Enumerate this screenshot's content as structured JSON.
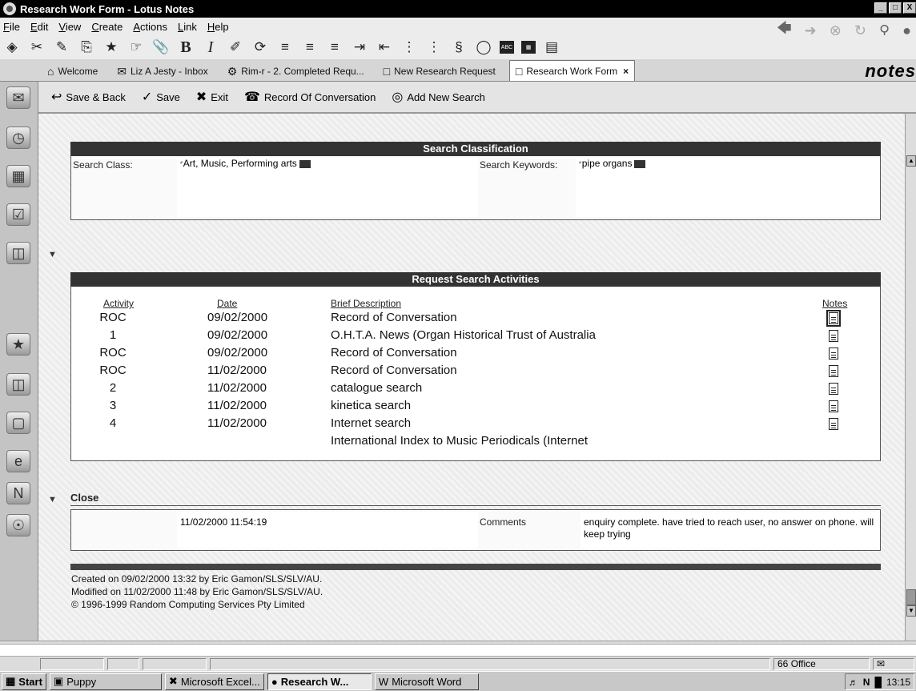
{
  "window": {
    "title": "Research Work Form - Lotus Notes",
    "min": "_",
    "max": "̸",
    "close": "X"
  },
  "menu": [
    "File",
    "Edit",
    "View",
    "Create",
    "Actions",
    "Link",
    "Help"
  ],
  "tabs": [
    {
      "label": "Welcome",
      "icon": "⌂"
    },
    {
      "label": "Liz A Jesty - Inbox",
      "icon": "✉"
    },
    {
      "label": "Rim-r - 2. Completed Requ...",
      "icon": "⚙"
    },
    {
      "label": "New Research Request",
      "icon": "□"
    },
    {
      "label": "Research Work Form",
      "icon": "□",
      "close": "×"
    }
  ],
  "brand": "notes",
  "actions": [
    {
      "label": "Save & Back",
      "icon": "↩"
    },
    {
      "label": "Save",
      "icon": "✓"
    },
    {
      "label": "Exit",
      "icon": "✖"
    },
    {
      "label": "Record Of Conversation",
      "icon": "☎"
    },
    {
      "label": "Add New Search",
      "icon": "◎"
    }
  ],
  "classification": {
    "heading": "Search Classification",
    "class_label": "Search Class:",
    "class_value": "Art, Music, Performing arts",
    "keywords_label": "Search Keywords:",
    "keywords_value": "pipe organs"
  },
  "activities": {
    "heading": "Request Search Activities",
    "columns": {
      "activity": "Activity",
      "date": "Date",
      "desc": "Brief Description",
      "notes": "Notes"
    },
    "rows": [
      {
        "activity": "ROC",
        "date": "09/02/2000",
        "desc": "Record of Conversation",
        "note": true
      },
      {
        "activity": "1",
        "date": "09/02/2000",
        "desc": "O.H.T.A. News (Organ Historical Trust of Australia",
        "note": true
      },
      {
        "activity": "ROC",
        "date": "09/02/2000",
        "desc": "Record of Conversation",
        "note": true
      },
      {
        "activity": "ROC",
        "date": "11/02/2000",
        "desc": "Record of Conversation",
        "note": true
      },
      {
        "activity": "2",
        "date": "11/02/2000",
        "desc": "catalogue search",
        "note": true
      },
      {
        "activity": "3",
        "date": "11/02/2000",
        "desc": "kinetica search",
        "note": true
      },
      {
        "activity": "4",
        "date": "11/02/2000",
        "desc": "Internet search",
        "note": true
      },
      {
        "activity": "",
        "date": "",
        "desc": "International Index to Music Periodicals (Internet",
        "note": false
      }
    ]
  },
  "close": {
    "heading": "Close",
    "datetime": "11/02/2000 11:54:19",
    "comments_label": "Comments",
    "comments_value": "enquiry complete. have tried to reach user, no answer on phone. will keep trying"
  },
  "footer": {
    "created": "Created  on 09/02/2000 13:32 by Eric Gamon/SLS/SLV/AU.",
    "modified": "Modified on 11/02/2000 11:48 by Eric Gamon/SLS/SLV/AU.",
    "copyright": "© 1996-1999 Random Computing Services Pty Limited"
  },
  "status": {
    "location": "Office",
    "loc_icon": "66"
  },
  "taskbar": {
    "start": "Start",
    "items": [
      {
        "label": "Puppy",
        "pressed": false
      },
      {
        "label": "Microsoft Excel...",
        "pressed": false
      },
      {
        "label": "Research W...",
        "pressed": true
      },
      {
        "label": "Microsoft Word",
        "pressed": false
      }
    ],
    "clock": "13:15"
  }
}
